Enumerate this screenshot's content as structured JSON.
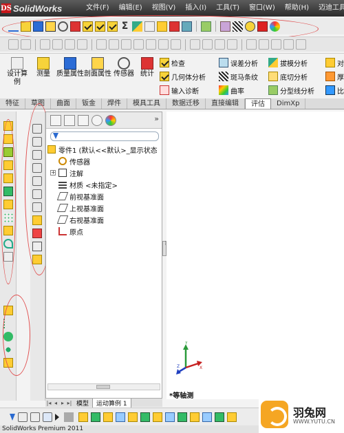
{
  "app": {
    "title": "SolidWorks",
    "logo_mark": "DS"
  },
  "menu": [
    {
      "label": "文件(F)"
    },
    {
      "label": "编辑(E)"
    },
    {
      "label": "视图(V)"
    },
    {
      "label": "插入(I)"
    },
    {
      "label": "工具(T)"
    },
    {
      "label": "窗口(W)"
    },
    {
      "label": "帮助(H)"
    },
    {
      "label": "迈迪工具"
    }
  ],
  "command_manager": {
    "big_buttons": [
      {
        "label": "设计算例",
        "icon": "design-study-icon"
      },
      {
        "label": "测量",
        "icon": "measure-icon"
      },
      {
        "label": "质量属性",
        "icon": "mass-properties-icon"
      },
      {
        "label": "剖面属性",
        "icon": "section-properties-icon"
      },
      {
        "label": "传感器",
        "icon": "sensor-icon"
      },
      {
        "label": "统计",
        "icon": "statistics-icon"
      }
    ],
    "column1": [
      {
        "label": "检查",
        "icon": "check-icon"
      },
      {
        "label": "几何体分析",
        "icon": "geometry-analysis-icon"
      },
      {
        "label": "输入诊断",
        "icon": "import-diagnostics-icon"
      }
    ],
    "column2": [
      {
        "label": "误差分析",
        "icon": "deviation-analysis-icon"
      },
      {
        "label": "斑马条纹",
        "icon": "zebra-stripes-icon"
      },
      {
        "label": "曲率",
        "icon": "curvature-icon"
      }
    ],
    "column3": [
      {
        "label": "拔模分析",
        "icon": "draft-analysis-icon"
      },
      {
        "label": "底切分析",
        "icon": "undercut-analysis-icon"
      },
      {
        "label": "分型线分析",
        "icon": "parting-line-analysis-icon"
      }
    ],
    "column4": [
      {
        "label": "对",
        "icon": "symmetry-check-icon"
      },
      {
        "label": "厚",
        "icon": "thickness-analysis-icon"
      },
      {
        "label": "比",
        "icon": "compare-icon"
      }
    ]
  },
  "tabs": [
    {
      "label": "特征"
    },
    {
      "label": "草图"
    },
    {
      "label": "曲面"
    },
    {
      "label": "钣金"
    },
    {
      "label": "焊件"
    },
    {
      "label": "模具工具"
    },
    {
      "label": "数据迁移"
    },
    {
      "label": "直接编辑"
    },
    {
      "label": "评估"
    },
    {
      "label": "DimXp"
    }
  ],
  "active_tab": "评估",
  "panel": {
    "expand": "»",
    "tree": [
      {
        "label": "零件1  (默认<<默认>_显示状态",
        "icon": "part-icon"
      },
      {
        "label": "传感器",
        "icon": "sensor-icon"
      },
      {
        "label": "注解",
        "icon": "annotations-icon"
      },
      {
        "label": "材质 <未指定>",
        "icon": "material-icon"
      },
      {
        "label": "前视基准面",
        "icon": "plane-icon"
      },
      {
        "label": "上视基准面",
        "icon": "plane-icon"
      },
      {
        "label": "右视基准面",
        "icon": "plane-icon"
      },
      {
        "label": "原点",
        "icon": "origin-icon"
      }
    ]
  },
  "bottom_tabs": [
    {
      "label": "模型"
    },
    {
      "label": "运动算例 1"
    }
  ],
  "viewport": {
    "view_label": "*等轴测",
    "axis_x": "X",
    "axis_y": "Y",
    "axis_z": "Z"
  },
  "watermark": {
    "title": "羽兔网",
    "url": "WWW.YUTU.CN"
  },
  "status": {
    "text": "SolidWorks Premium 2011"
  },
  "colors": {
    "accent_red": "#e05050",
    "title_bg": "#3a3a3a",
    "watermark_orange": "#f5a623"
  }
}
